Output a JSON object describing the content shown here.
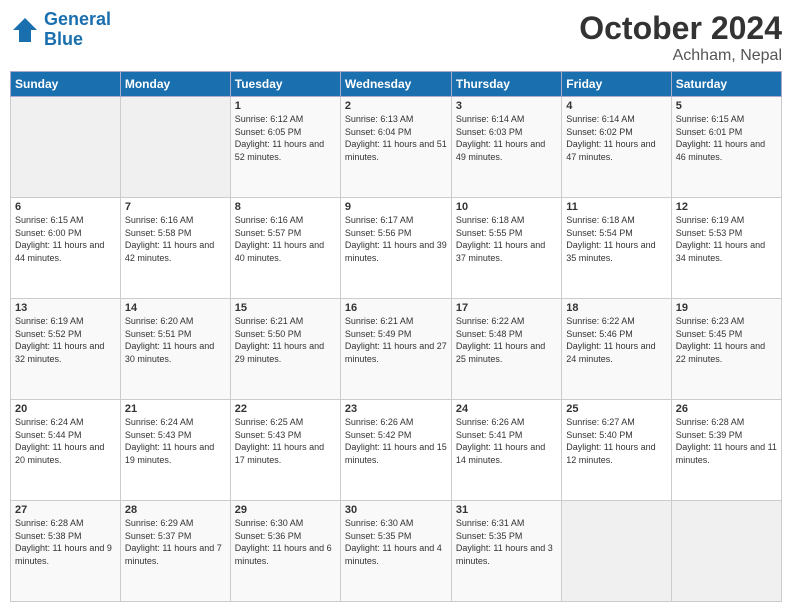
{
  "header": {
    "logo_line1": "General",
    "logo_line2": "Blue",
    "month": "October 2024",
    "location": "Achham, Nepal"
  },
  "weekdays": [
    "Sunday",
    "Monday",
    "Tuesday",
    "Wednesday",
    "Thursday",
    "Friday",
    "Saturday"
  ],
  "weeks": [
    [
      {
        "day": "",
        "info": ""
      },
      {
        "day": "",
        "info": ""
      },
      {
        "day": "1",
        "info": "Sunrise: 6:12 AM\nSunset: 6:05 PM\nDaylight: 11 hours and 52 minutes."
      },
      {
        "day": "2",
        "info": "Sunrise: 6:13 AM\nSunset: 6:04 PM\nDaylight: 11 hours and 51 minutes."
      },
      {
        "day": "3",
        "info": "Sunrise: 6:14 AM\nSunset: 6:03 PM\nDaylight: 11 hours and 49 minutes."
      },
      {
        "day": "4",
        "info": "Sunrise: 6:14 AM\nSunset: 6:02 PM\nDaylight: 11 hours and 47 minutes."
      },
      {
        "day": "5",
        "info": "Sunrise: 6:15 AM\nSunset: 6:01 PM\nDaylight: 11 hours and 46 minutes."
      }
    ],
    [
      {
        "day": "6",
        "info": "Sunrise: 6:15 AM\nSunset: 6:00 PM\nDaylight: 11 hours and 44 minutes."
      },
      {
        "day": "7",
        "info": "Sunrise: 6:16 AM\nSunset: 5:58 PM\nDaylight: 11 hours and 42 minutes."
      },
      {
        "day": "8",
        "info": "Sunrise: 6:16 AM\nSunset: 5:57 PM\nDaylight: 11 hours and 40 minutes."
      },
      {
        "day": "9",
        "info": "Sunrise: 6:17 AM\nSunset: 5:56 PM\nDaylight: 11 hours and 39 minutes."
      },
      {
        "day": "10",
        "info": "Sunrise: 6:18 AM\nSunset: 5:55 PM\nDaylight: 11 hours and 37 minutes."
      },
      {
        "day": "11",
        "info": "Sunrise: 6:18 AM\nSunset: 5:54 PM\nDaylight: 11 hours and 35 minutes."
      },
      {
        "day": "12",
        "info": "Sunrise: 6:19 AM\nSunset: 5:53 PM\nDaylight: 11 hours and 34 minutes."
      }
    ],
    [
      {
        "day": "13",
        "info": "Sunrise: 6:19 AM\nSunset: 5:52 PM\nDaylight: 11 hours and 32 minutes."
      },
      {
        "day": "14",
        "info": "Sunrise: 6:20 AM\nSunset: 5:51 PM\nDaylight: 11 hours and 30 minutes."
      },
      {
        "day": "15",
        "info": "Sunrise: 6:21 AM\nSunset: 5:50 PM\nDaylight: 11 hours and 29 minutes."
      },
      {
        "day": "16",
        "info": "Sunrise: 6:21 AM\nSunset: 5:49 PM\nDaylight: 11 hours and 27 minutes."
      },
      {
        "day": "17",
        "info": "Sunrise: 6:22 AM\nSunset: 5:48 PM\nDaylight: 11 hours and 25 minutes."
      },
      {
        "day": "18",
        "info": "Sunrise: 6:22 AM\nSunset: 5:46 PM\nDaylight: 11 hours and 24 minutes."
      },
      {
        "day": "19",
        "info": "Sunrise: 6:23 AM\nSunset: 5:45 PM\nDaylight: 11 hours and 22 minutes."
      }
    ],
    [
      {
        "day": "20",
        "info": "Sunrise: 6:24 AM\nSunset: 5:44 PM\nDaylight: 11 hours and 20 minutes."
      },
      {
        "day": "21",
        "info": "Sunrise: 6:24 AM\nSunset: 5:43 PM\nDaylight: 11 hours and 19 minutes."
      },
      {
        "day": "22",
        "info": "Sunrise: 6:25 AM\nSunset: 5:43 PM\nDaylight: 11 hours and 17 minutes."
      },
      {
        "day": "23",
        "info": "Sunrise: 6:26 AM\nSunset: 5:42 PM\nDaylight: 11 hours and 15 minutes."
      },
      {
        "day": "24",
        "info": "Sunrise: 6:26 AM\nSunset: 5:41 PM\nDaylight: 11 hours and 14 minutes."
      },
      {
        "day": "25",
        "info": "Sunrise: 6:27 AM\nSunset: 5:40 PM\nDaylight: 11 hours and 12 minutes."
      },
      {
        "day": "26",
        "info": "Sunrise: 6:28 AM\nSunset: 5:39 PM\nDaylight: 11 hours and 11 minutes."
      }
    ],
    [
      {
        "day": "27",
        "info": "Sunrise: 6:28 AM\nSunset: 5:38 PM\nDaylight: 11 hours and 9 minutes."
      },
      {
        "day": "28",
        "info": "Sunrise: 6:29 AM\nSunset: 5:37 PM\nDaylight: 11 hours and 7 minutes."
      },
      {
        "day": "29",
        "info": "Sunrise: 6:30 AM\nSunset: 5:36 PM\nDaylight: 11 hours and 6 minutes."
      },
      {
        "day": "30",
        "info": "Sunrise: 6:30 AM\nSunset: 5:35 PM\nDaylight: 11 hours and 4 minutes."
      },
      {
        "day": "31",
        "info": "Sunrise: 6:31 AM\nSunset: 5:35 PM\nDaylight: 11 hours and 3 minutes."
      },
      {
        "day": "",
        "info": ""
      },
      {
        "day": "",
        "info": ""
      }
    ]
  ]
}
